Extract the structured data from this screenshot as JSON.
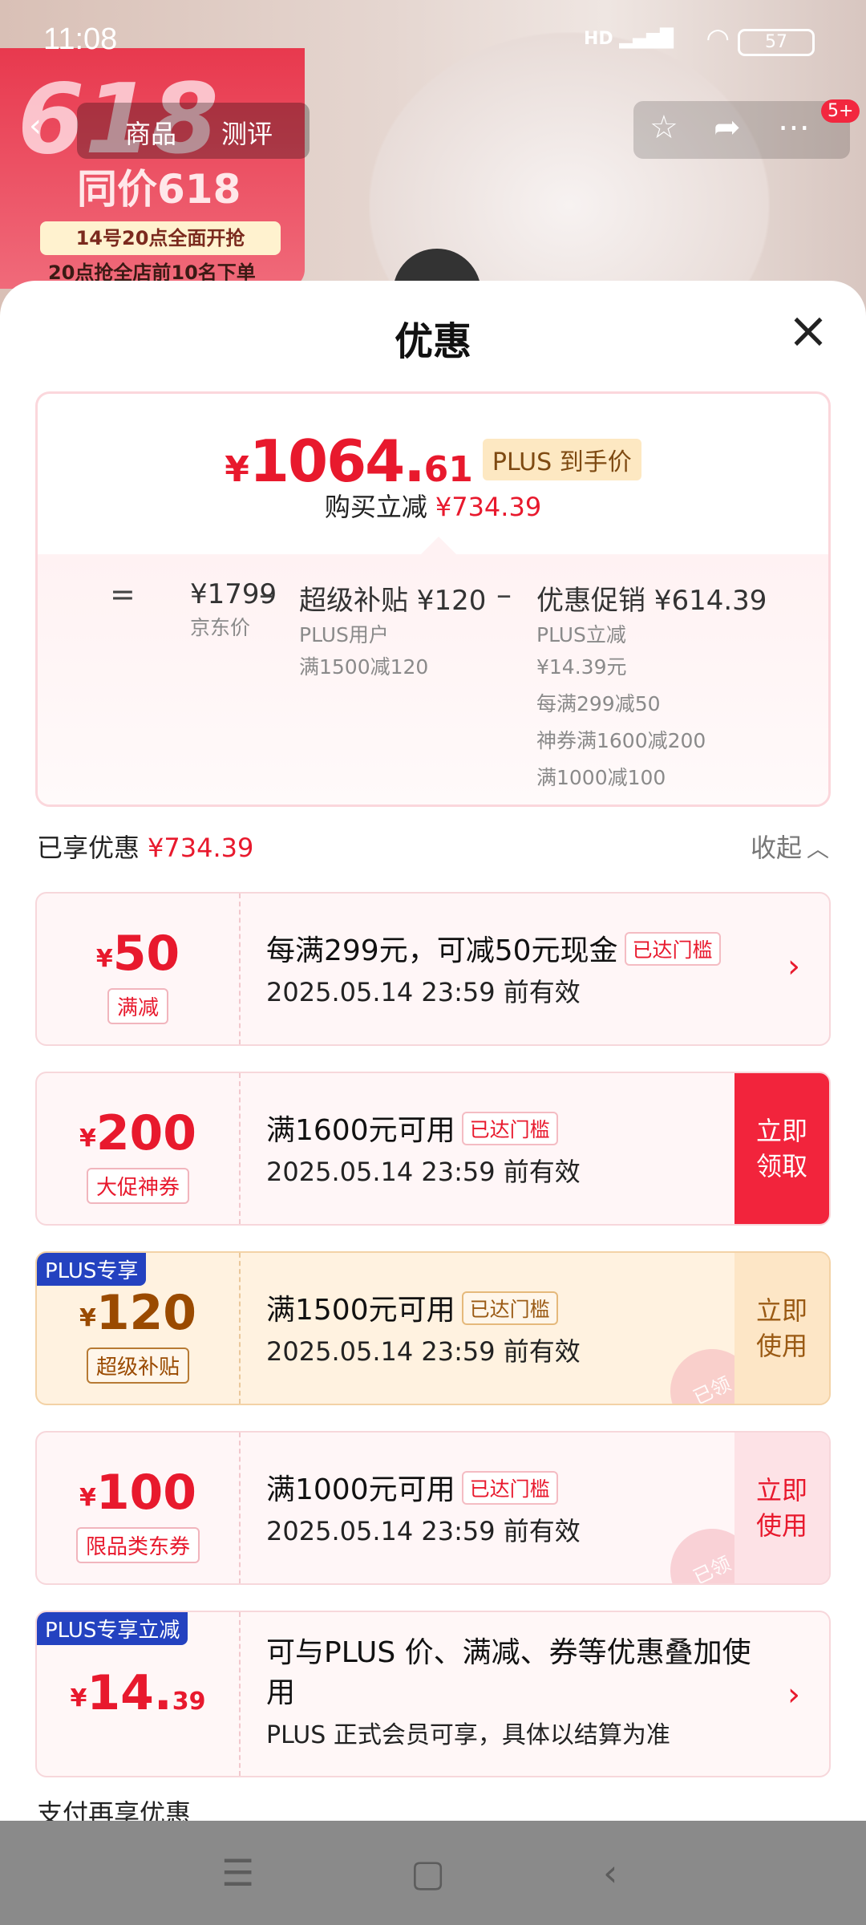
{
  "status_bar": {
    "time": "11:08",
    "signal": "HD",
    "wifi": "wifi-icon",
    "battery": "57"
  },
  "background": {
    "promo_big": "618",
    "promo_line1": "同价618",
    "promo_chip": "14号20点全面开抢",
    "promo_line2": "20点抢全店前10名下单",
    "tab_product": "商品",
    "tab_review": "测评",
    "badge": "5+"
  },
  "sheet": {
    "title": "优惠",
    "summary": {
      "price_symbol": "¥",
      "price_int": "1064.",
      "price_dec": "61",
      "plus_tag": "PLUS 到手价",
      "reduce_label": "购买立减",
      "reduce_amount": "¥734.39",
      "breakdown": [
        {
          "op": "=",
          "head": "¥1799",
          "lines": [
            "京东价"
          ]
        },
        {
          "op": "–",
          "head": "超级补贴 ¥120",
          "lines": [
            "PLUS用户",
            "满1500减120"
          ]
        },
        {
          "op": "–",
          "head": "优惠促销 ¥614.39",
          "lines": [
            "PLUS立减",
            "¥14.39元"
          ],
          "extra": [
            "每满299减50",
            "神券满1600减200",
            "满1000减100"
          ]
        }
      ]
    },
    "enjoyed_label": "已享优惠",
    "enjoyed_amount": "¥734.39",
    "collapse_label": "收起",
    "coupons": [
      {
        "symbol": "¥",
        "amount": "50",
        "label": "满减",
        "title": "每满299元，可减50元现金",
        "tag": "已达门槛",
        "date": "2025.05.14 23:59 前有效",
        "action": ""
      },
      {
        "symbol": "¥",
        "amount": "200",
        "label": "大促神券",
        "title": "满1600元可用",
        "tag": "已达门槛",
        "date": "2025.05.14 23:59 前有效",
        "action": "立即领取"
      },
      {
        "symbol": "¥",
        "amount": "120",
        "label": "超级补贴",
        "corner": "PLUS专享",
        "title": "满1500元可用",
        "tag": "已达门槛",
        "date": "2025.05.14 23:59 前有效",
        "action": "立即使用",
        "stamp": "已领"
      },
      {
        "symbol": "¥",
        "amount": "100",
        "label": "限品类东券",
        "title": "满1000元可用",
        "tag": "已达门槛",
        "date": "2025.05.14 23:59 前有效",
        "action": "立即使用",
        "stamp": "已领"
      },
      {
        "symbol": "¥",
        "amount": "14.",
        "decimal": "39",
        "corner": "PLUS专享立减",
        "title": "可与PLUS 价、满减、券等优惠叠加使用",
        "date": "PLUS 正式会员可享，具体以结算为准"
      }
    ],
    "pay_more": "支付再享优惠"
  },
  "colors": {
    "accent": "#e8192d",
    "gold": "#9a4a00",
    "plus_blue": "#2442c0"
  }
}
